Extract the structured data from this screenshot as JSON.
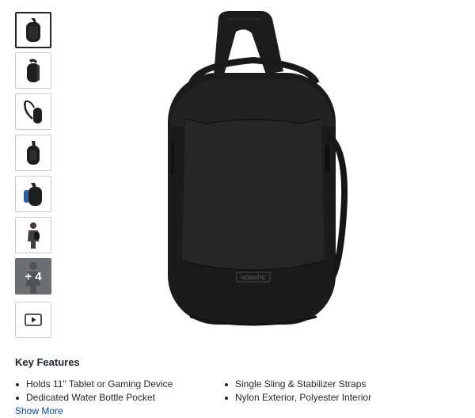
{
  "gallery": {
    "thumbnails": [
      {
        "icon": "backpack-front-icon",
        "selected": true
      },
      {
        "icon": "backpack-angle-icon",
        "selected": false
      },
      {
        "icon": "backpack-strap-icon",
        "selected": false
      },
      {
        "icon": "backpack-back-icon",
        "selected": false
      },
      {
        "icon": "backpack-bottle-icon",
        "selected": false
      },
      {
        "icon": "person-wearing-icon",
        "selected": false
      }
    ],
    "more_label": "+ 4",
    "video_icon": "play-video-icon"
  },
  "product": {
    "image_icon": "sling-backpack-image",
    "logo_text": "NOMATIC"
  },
  "features": {
    "title": "Key Features",
    "items": [
      "Holds 11\" Tablet or Gaming Device",
      "Single Sling & Stabilizer Straps",
      "Dedicated Water Bottle Pocket",
      "Nylon Exterior, Polyester Interior"
    ],
    "show_more": "Show More"
  },
  "colors": {
    "link": "#0046be",
    "text": "#1d252c",
    "thumb_border": "#c5cbd5",
    "more_bg": "#6b6e73"
  }
}
